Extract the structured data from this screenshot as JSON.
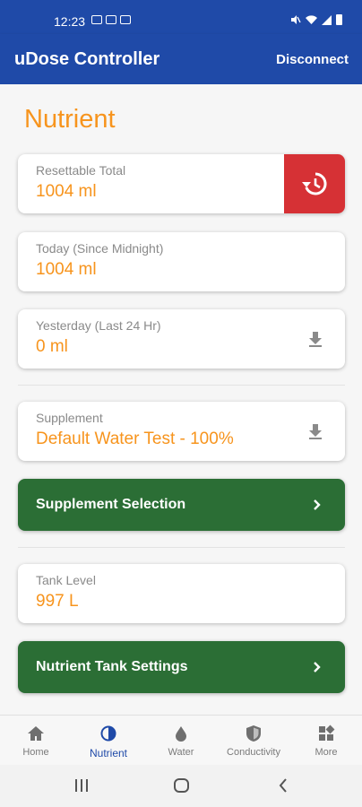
{
  "status_bar": {
    "time": "12:23"
  },
  "app_bar": {
    "title": "uDose Controller",
    "disconnect_label": "Disconnect"
  },
  "page": {
    "heading": "Nutrient"
  },
  "cards": {
    "resettable": {
      "label": "Resettable Total",
      "value": "1004 ml",
      "action_icon": "history-icon"
    },
    "today": {
      "label": "Today (Since Midnight)",
      "value": "1004 ml"
    },
    "yesterday": {
      "label": "Yesterday (Last 24 Hr)",
      "value": "0 ml",
      "action_icon": "download-icon"
    },
    "supplement": {
      "label": "Supplement",
      "value": "Default Water Test - 100%",
      "action_icon": "download-icon"
    },
    "tank_level": {
      "label": "Tank Level",
      "value": "997 L"
    }
  },
  "buttons": {
    "supplement_selection": "Supplement Selection",
    "nutrient_tank_settings": "Nutrient Tank Settings"
  },
  "bottom_nav": {
    "items": [
      {
        "label": "Home",
        "icon": "home-icon"
      },
      {
        "label": "Nutrient",
        "icon": "nutrient-icon",
        "active": true
      },
      {
        "label": "Water",
        "icon": "water-drop-icon"
      },
      {
        "label": "Conductivity",
        "icon": "shield-icon"
      },
      {
        "label": "More",
        "icon": "grid-icon"
      }
    ]
  },
  "colors": {
    "primary": "#1f4aa8",
    "accent_orange": "#f7941d",
    "danger_red": "#d63135",
    "success_green": "#2b6e35"
  }
}
